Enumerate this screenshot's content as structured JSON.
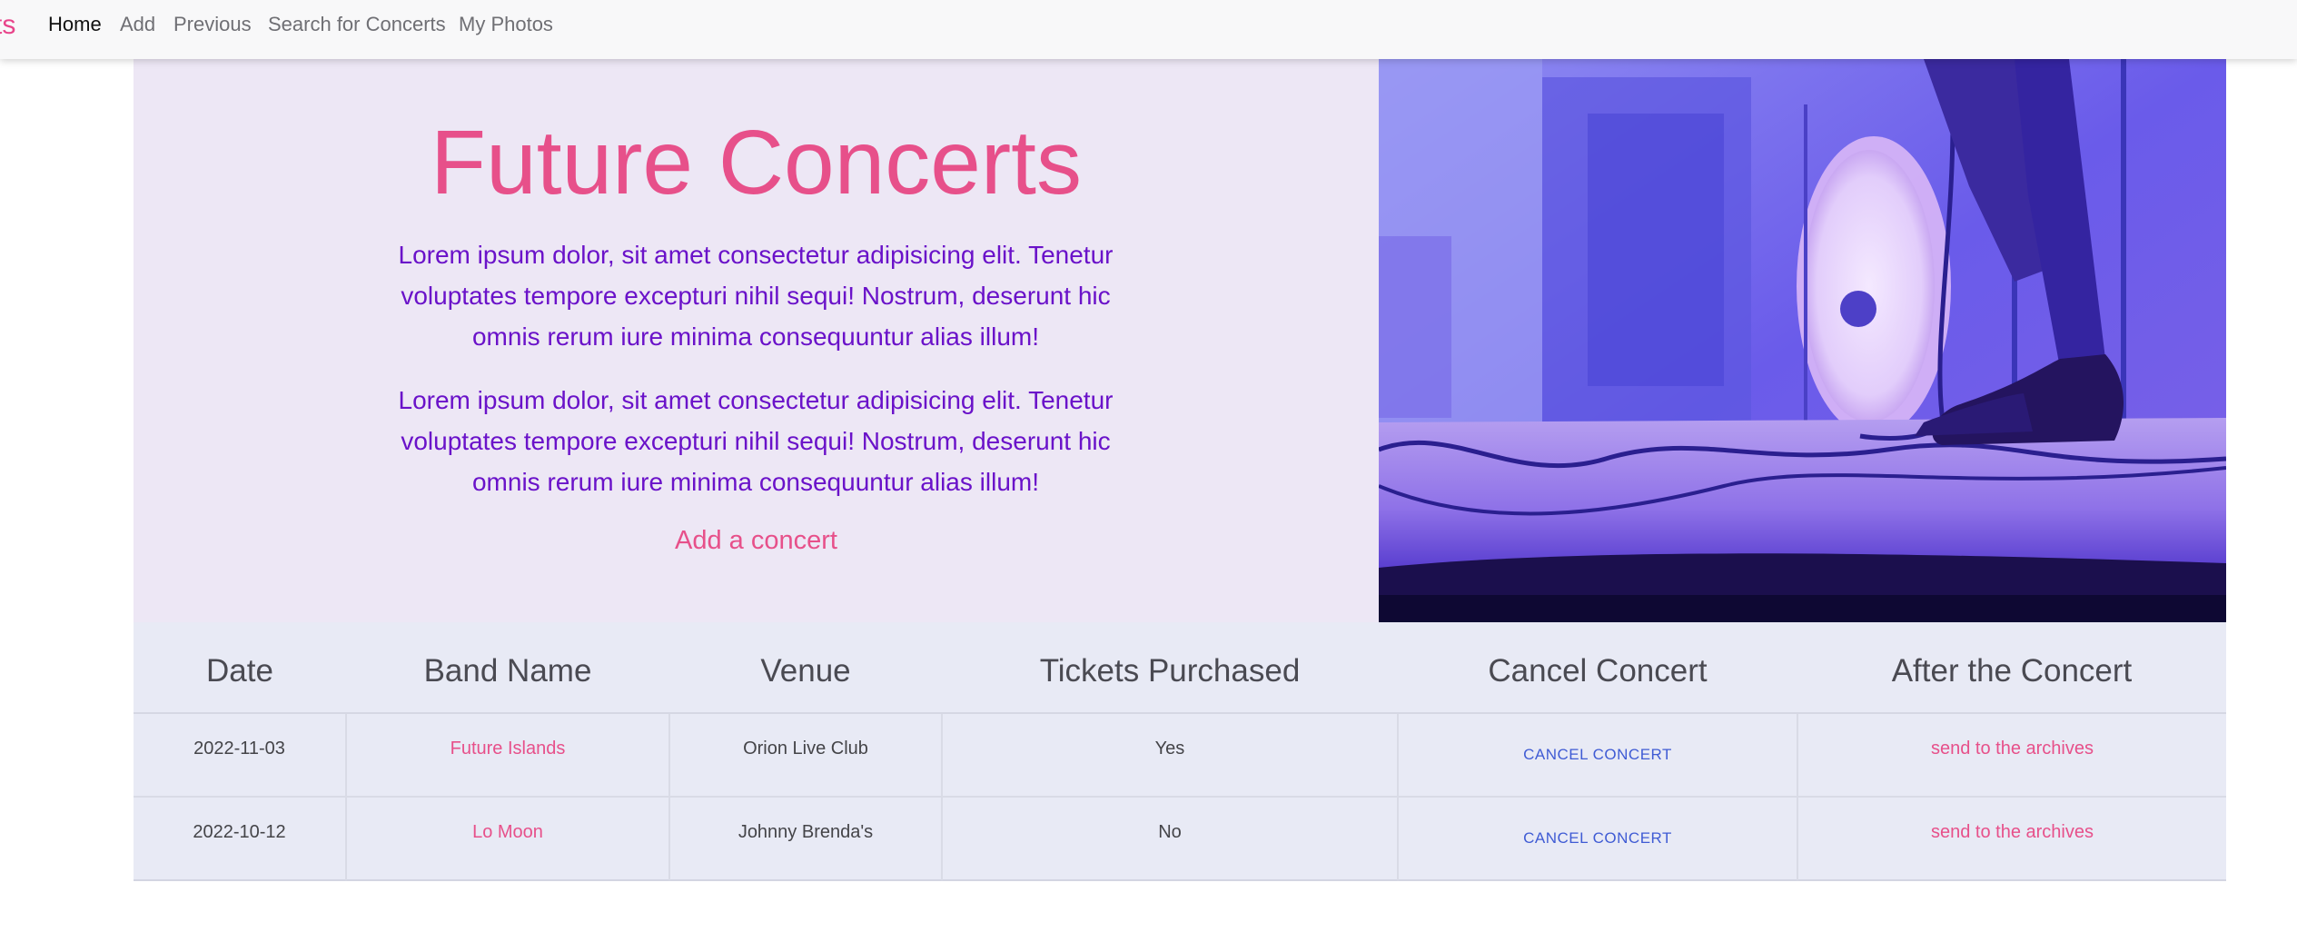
{
  "nav": {
    "brand": "ts",
    "links": [
      "Home",
      "Add",
      "Previous",
      "Search for Concerts",
      "My Photos"
    ],
    "active": "Home"
  },
  "hero": {
    "title": "Future Concerts",
    "paragraphs": [
      "Lorem ipsum dolor, sit amet consectetur adipisicing elit. Tenetur voluptates tempore excepturi nihil sequi! Nostrum, deserunt hic omnis rerum iure minima consequuntur alias illum!",
      "Lorem ipsum dolor, sit amet consectetur adipisicing elit. Tenetur voluptates tempore excepturi nihil sequi! Nostrum, deserunt hic omnis rerum iure minima consequuntur alias illum!"
    ],
    "cta": "Add a concert"
  },
  "photo": {
    "icon": "concert-stage-photo"
  },
  "table": {
    "headers": [
      "Date",
      "Band Name",
      "Venue",
      "Tickets Purchased",
      "Cancel Concert",
      "After the Concert"
    ],
    "rows": [
      {
        "date": "2022-11-03",
        "band": "Future Islands",
        "venue": "Orion Live Club",
        "tickets": "Yes",
        "cancel": "CANCEL CONCERT",
        "after": "send to the archives"
      },
      {
        "date": "2022-10-12",
        "band": "Lo Moon",
        "venue": "Johnny Brenda's",
        "tickets": "No",
        "cancel": "CANCEL CONCERT",
        "after": "send to the archives"
      }
    ]
  },
  "colors": {
    "accent_pink": "#e7508a",
    "paragraph_purple": "#6a12c9",
    "hero_bg": "#ede7f5",
    "table_bg": "#e8eaf5",
    "cancel_blue": "#3f5bd4"
  }
}
